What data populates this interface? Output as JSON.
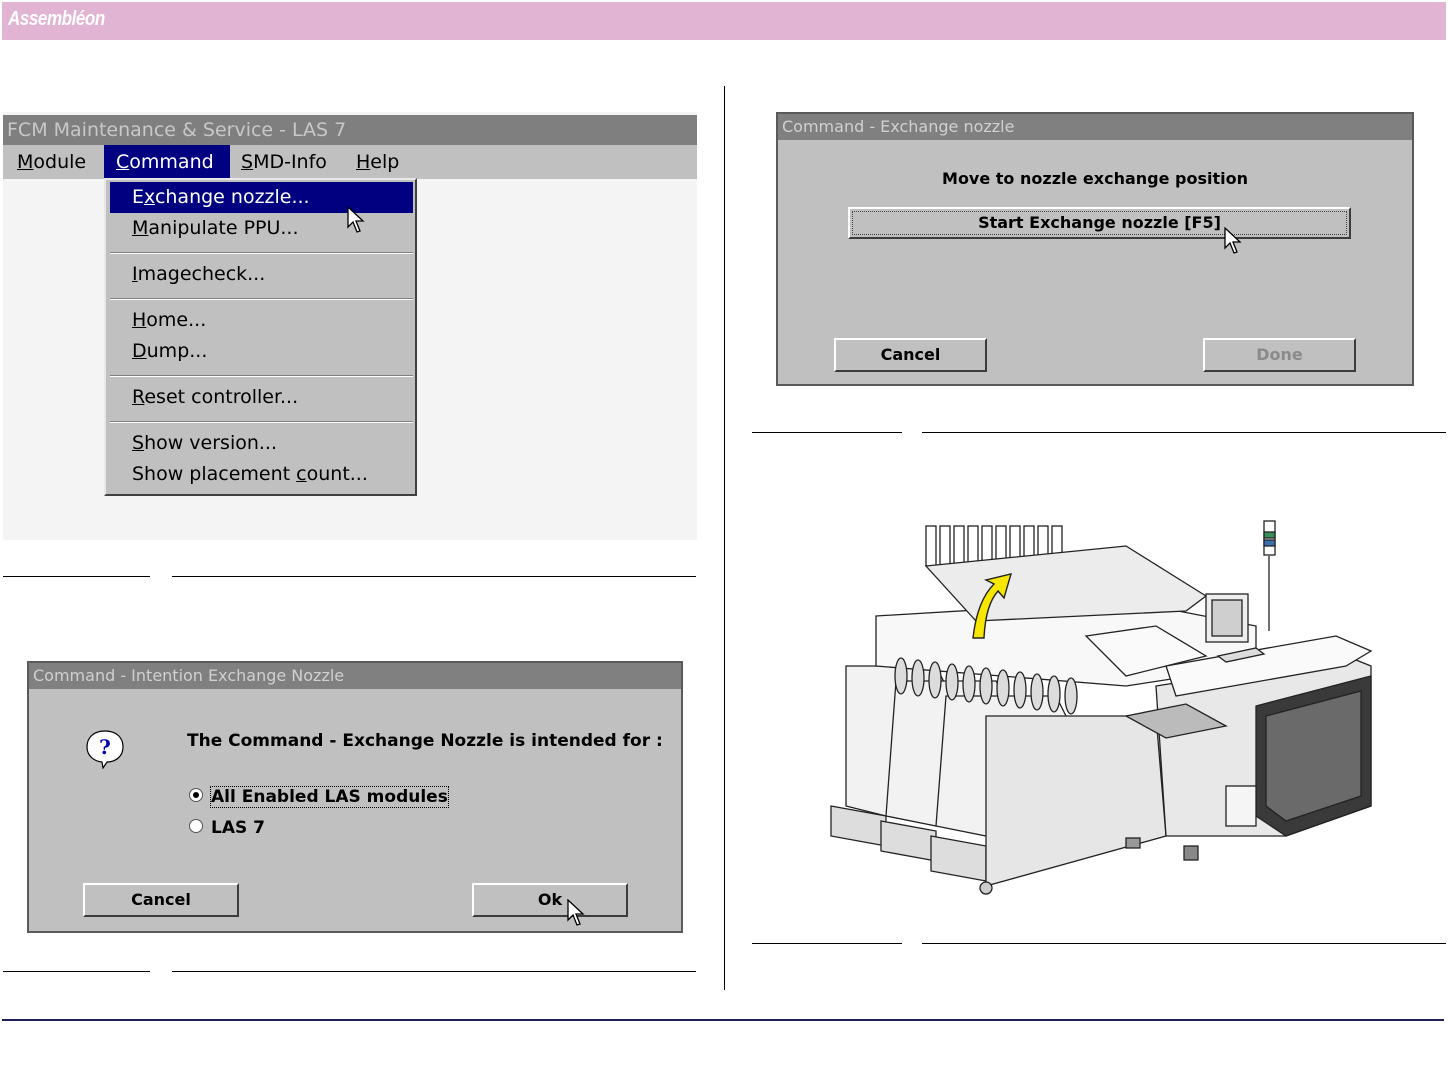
{
  "header": {
    "brand": "Assembléon"
  },
  "shot1": {
    "title": "FCM Maintenance & Service - LAS  7",
    "menubar": [
      {
        "key": "M",
        "rest": "odule"
      },
      {
        "key": "C",
        "rest": "ommand"
      },
      {
        "key": "S",
        "rest": "MD-Info"
      },
      {
        "key": "H",
        "rest": "elp"
      }
    ],
    "menu_items": [
      {
        "pre": "E",
        "key": "x",
        "rest": "change nozzle..."
      },
      {
        "pre": "",
        "key": "M",
        "rest": "anipulate PPU..."
      },
      {
        "pre": "",
        "key": "I",
        "rest": "magecheck..."
      },
      {
        "pre": "",
        "key": "H",
        "rest": "ome..."
      },
      {
        "pre": "",
        "key": "D",
        "rest": "ump..."
      },
      {
        "pre": "",
        "key": "R",
        "rest": "eset controller..."
      },
      {
        "pre": "",
        "key": "S",
        "rest": "how version..."
      },
      {
        "pre": "Show placement ",
        "key": "c",
        "rest": "ount..."
      }
    ]
  },
  "dialog_intention": {
    "title": "Command - Intention Exchange Nozzle",
    "message": "The Command - Exchange Nozzle is intended for :",
    "options": [
      "All Enabled LAS modules",
      "LAS  7"
    ],
    "selected_option": 0,
    "cancel_label": "Cancel",
    "ok_label": "Ok"
  },
  "dialog_exchange": {
    "title": "Command - Exchange nozzle",
    "message": "Move to nozzle exchange position",
    "start_label": "Start Exchange nozzle [F5]",
    "cancel_label": "Cancel",
    "done_label": "Done"
  },
  "colors": {
    "header": "#e0b4d2",
    "selection": "#000080",
    "window_gray": "#c0c0c0",
    "footer_line": "#1f1f55",
    "arrow_yellow": "#f6e600"
  }
}
